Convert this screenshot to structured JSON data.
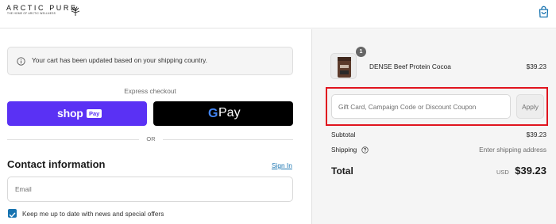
{
  "brand": {
    "name": "ARCTIC PURE",
    "tagline": "THE HOME OF ARCTIC WELLNESS"
  },
  "notice": {
    "text": "Your cart has been updated based on your shipping country."
  },
  "express_checkout": {
    "label": "Express checkout",
    "shop_pay": {
      "word": "shop",
      "badge": "Pay"
    },
    "google_pay": {
      "letter": "G",
      "word": "Pay"
    },
    "divider": "OR"
  },
  "contact": {
    "title": "Contact information",
    "sign_in": "Sign In",
    "email_placeholder": "Email",
    "newsletter_label": "Keep me up to date with news and special offers",
    "newsletter_checked": true
  },
  "order": {
    "item": {
      "quantity": "1",
      "name": "DENSE Beef Protein Cocoa",
      "price": "$39.23"
    },
    "discount": {
      "placeholder": "Gift Card, Campaign Code or Discount Coupon",
      "apply_label": "Apply"
    },
    "subtotal_label": "Subtotal",
    "subtotal_value": "$39.23",
    "shipping_label": "Shipping",
    "shipping_value": "Enter shipping address",
    "total_label": "Total",
    "currency": "USD",
    "total_value": "$39.23"
  },
  "colors": {
    "shop_pay": "#5a31f4",
    "google_pay": "#000000",
    "link": "#1773b0",
    "highlight": "#e0141e"
  }
}
